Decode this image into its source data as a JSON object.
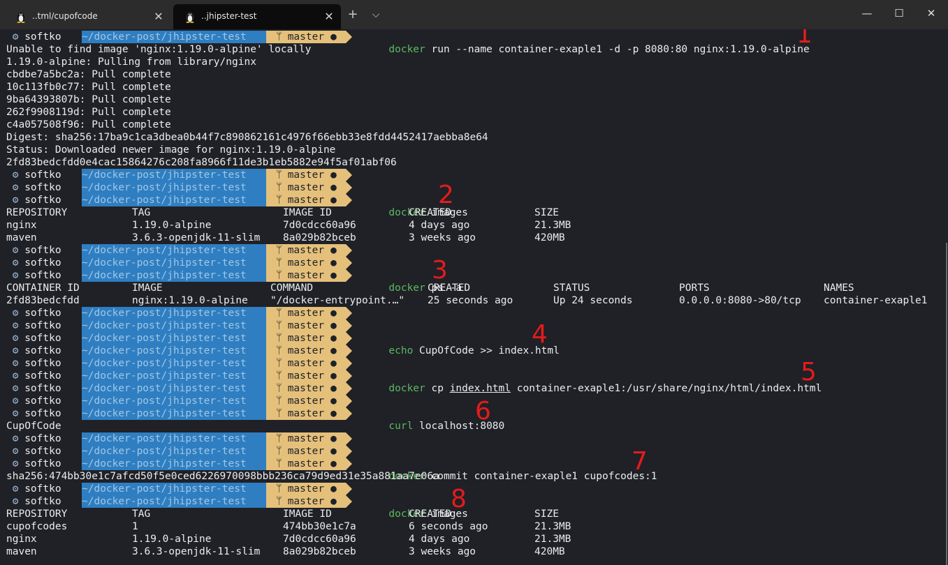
{
  "tabs": [
    {
      "title": "..tml/cupofcode",
      "icon": "linux-tux-icon",
      "active": false
    },
    {
      "title": "..jhipster-test",
      "icon": "linux-tux-icon",
      "active": true
    }
  ],
  "titlebar": {
    "new_tab": "+",
    "dropdown": "⌵",
    "minimize": "—",
    "maximize": "☐",
    "close": "✕"
  },
  "prompt": {
    "user": "softko",
    "path": "~/docker-post/jhipster-test",
    "branch": "master",
    "git_glyph": "ᛘ",
    "dirty_glyph": "●"
  },
  "annotation_color": "#e51b1b",
  "annotations": [
    "1",
    "2",
    "3",
    "4",
    "5",
    "6",
    "7",
    "8"
  ],
  "commands": {
    "c1": {
      "kw": "docker",
      "rest": " run --name container-exaple1 -d -p 8080:80 nginx:1.19.0-alpine"
    },
    "c2": {
      "kw": "docker",
      "rest": " images"
    },
    "c3": {
      "kw": "docker",
      "rest": " ps -a"
    },
    "c4": {
      "kw": "echo",
      "rest": " CupOfCode >> index.html"
    },
    "c5": {
      "kw": "docker",
      "rest_a": " cp ",
      "file": "index.html",
      "rest_b": " container-exaple1:/usr/share/nginx/html/index.html"
    },
    "c6": {
      "kw": "curl",
      "rest": " localhost:8080"
    },
    "c7": {
      "kw": "docker",
      "rest": " commit container-exaple1 cupofcodes:1"
    },
    "c8": {
      "kw": "docker",
      "rest": " images"
    }
  },
  "output": {
    "pull": [
      "Unable to find image 'nginx:1.19.0-alpine' locally",
      "1.19.0-alpine: Pulling from library/nginx",
      "cbdbe7a5bc2a: Pull complete",
      "10c113fb0c77: Pull complete",
      "9ba64393807b: Pull complete",
      "262f9908119d: Pull complete",
      "c4a057508f96: Pull complete",
      "Digest: sha256:17ba9c1ca3dbea0b44f7c890862161c4976f66ebb33e8fdd4452417aebba8e64",
      "Status: Downloaded newer image for nginx:1.19.0-alpine",
      "2fd83bedcfdd0e4cac15864276c208fa8966f11de3b1eb5882e94f5af01abf06"
    ],
    "curl": "CupOfCode",
    "commit": "sha256:474bb30e1c7afcd50f5e0ced6226970098bbb236ca79d9ed31e35a881aa7e06a"
  },
  "images1": {
    "headers": [
      "REPOSITORY",
      "TAG",
      "IMAGE ID",
      "CREATED",
      "SIZE"
    ],
    "rows": [
      [
        "nginx",
        "1.19.0-alpine",
        "7d0cdcc60a96",
        "4 days ago",
        "21.3MB"
      ],
      [
        "maven",
        "3.6.3-openjdk-11-slim",
        "8a029b82bceb",
        "3 weeks ago",
        "420MB"
      ]
    ]
  },
  "ps": {
    "headers": [
      "CONTAINER ID",
      "IMAGE",
      "COMMAND",
      "CREATED",
      "STATUS",
      "PORTS",
      "NAMES"
    ],
    "rows": [
      [
        "2fd83bedcfdd",
        "nginx:1.19.0-alpine",
        "\"/docker-entrypoint.…\"",
        "25 seconds ago",
        "Up 24 seconds",
        "0.0.0.0:8080->80/tcp",
        "container-exaple1"
      ]
    ]
  },
  "images2": {
    "headers": [
      "REPOSITORY",
      "TAG",
      "IMAGE ID",
      "CREATED",
      "SIZE"
    ],
    "rows": [
      [
        "cupofcodes",
        "1",
        "474bb30e1c7a",
        "6 seconds ago",
        "21.3MB"
      ],
      [
        "nginx",
        "1.19.0-alpine",
        "7d0cdcc60a96",
        "4 days ago",
        "21.3MB"
      ],
      [
        "maven",
        "3.6.3-openjdk-11-slim",
        "8a029b82bceb",
        "3 weeks ago",
        "420MB"
      ]
    ]
  }
}
